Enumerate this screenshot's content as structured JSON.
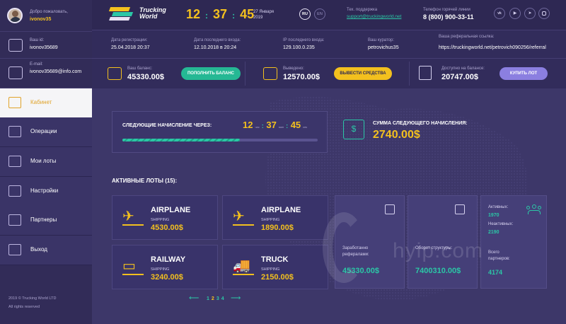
{
  "user": {
    "welcome": "Добро пожаловать,",
    "username": "ivonov35",
    "id_label": "Ваш id:",
    "id_value": "ivonov35689",
    "email_label": "E-mail:",
    "email_value": "ivonov35689@info.com"
  },
  "nav": {
    "items": [
      {
        "label": "Кабинет",
        "icon": "cabinet-icon"
      },
      {
        "label": "Операции",
        "icon": "operations-icon"
      },
      {
        "label": "Мои лоты",
        "icon": "lots-icon"
      },
      {
        "label": "Настройки",
        "icon": "settings-icon"
      },
      {
        "label": "Партнеры",
        "icon": "partners-icon"
      },
      {
        "label": "Выход",
        "icon": "exit-icon"
      }
    ]
  },
  "footer": {
    "copyright": "2019 © Trucking World LTD",
    "rights": "All rights reserved"
  },
  "header": {
    "brand_line1": "Trucking",
    "brand_line2": "World",
    "clock_h": "12",
    "clock_m": "37",
    "clock_s": "45",
    "date_line1": "27 Января",
    "date_line2": "2019",
    "lang_ru": "RU",
    "lang_en": "EN",
    "support_label": "Тех. поддержка",
    "support_email": "support@truckingworld.net",
    "hotline_label": "Телефон горячей линии",
    "hotline_value": "8 (800) 900-33-11",
    "social": [
      "vk-icon",
      "youtube-icon",
      "telegram-icon",
      "instagram-icon"
    ]
  },
  "info": {
    "reg_label": "Дата регистрации:",
    "reg_value": "25.04.2018 20:37",
    "last_label": "Дата последнего входа:",
    "last_value": "12.10.2018 в 20:24",
    "ip_label": "IP последнего входа:",
    "ip_value": "129.100.0.235",
    "curator_label": "Ваш куратор:",
    "curator_value": "petrovichus35",
    "ref_label": "Ваша реферальная ссылка:",
    "ref_value": "https://truckingworld.net/petrovich090256/referral"
  },
  "balances": {
    "balance_label": "Ваш баланс:",
    "balance_value": "45330.00$",
    "balance_button": "ПОПОЛНИТЬ БАЛАНС",
    "withdrawn_label": "Выведено:",
    "withdrawn_value": "12570.00$",
    "withdrawn_button": "ВЫВЕСТИ СРЕДСТВА",
    "available_label": "Доступно на балансе:",
    "available_value": "20747.00$",
    "available_button": "КУПИТЬ ЛОТ"
  },
  "accrual": {
    "next_label": "СЛЕДУЮЩИЕ НАЧИСЛЕНИЕ ЧЕРЕЗ:",
    "h": "12",
    "h_unit": "час",
    "m": "37",
    "m_unit": "мин",
    "s": "45",
    "s_unit": "сек",
    "progress": 0.6,
    "sum_label": "СУММА СЛЕДУЮЩЕГО НАЧИСЛЕНИЯ:",
    "sum_value": "2740.00$"
  },
  "lots": {
    "title": "АКТИВНЫЕ ЛОТЫ (15):",
    "items": [
      {
        "name": "AIRPLANE",
        "type": "SHIPPING",
        "price": "4530.00$",
        "icon": "airplane-icon"
      },
      {
        "name": "AIRPLANE",
        "type": "SHIPPING",
        "price": "1890.00$",
        "icon": "airplane-icon"
      },
      {
        "name": "RAILWAY",
        "type": "SHIPPING",
        "price": "3240.00$",
        "icon": "railway-icon"
      },
      {
        "name": "TRUCK",
        "type": "SHIPPING",
        "price": "2150.00$",
        "icon": "truck-icon"
      }
    ],
    "pages": [
      "1",
      "2",
      "3",
      "4"
    ],
    "current_page": "2"
  },
  "stats": {
    "ref_earned_label": "Заработанно рефералами:",
    "ref_earned_value": "45330.00$",
    "turnover_label": "Оборот структуры:",
    "turnover_value": "7400310.00$",
    "active_label": "Активных:",
    "active_value": "1970",
    "inactive_label": "Неактивных:",
    "inactive_value": "2190",
    "total_label": "Всего партнеров:",
    "total_value": "4174"
  },
  "watermark": "hyip.com",
  "colors": {
    "accent_yellow": "#f3c01e",
    "accent_green": "#2bc7a6",
    "accent_purple": "#8b7fe0",
    "bg": "#3d3769"
  }
}
